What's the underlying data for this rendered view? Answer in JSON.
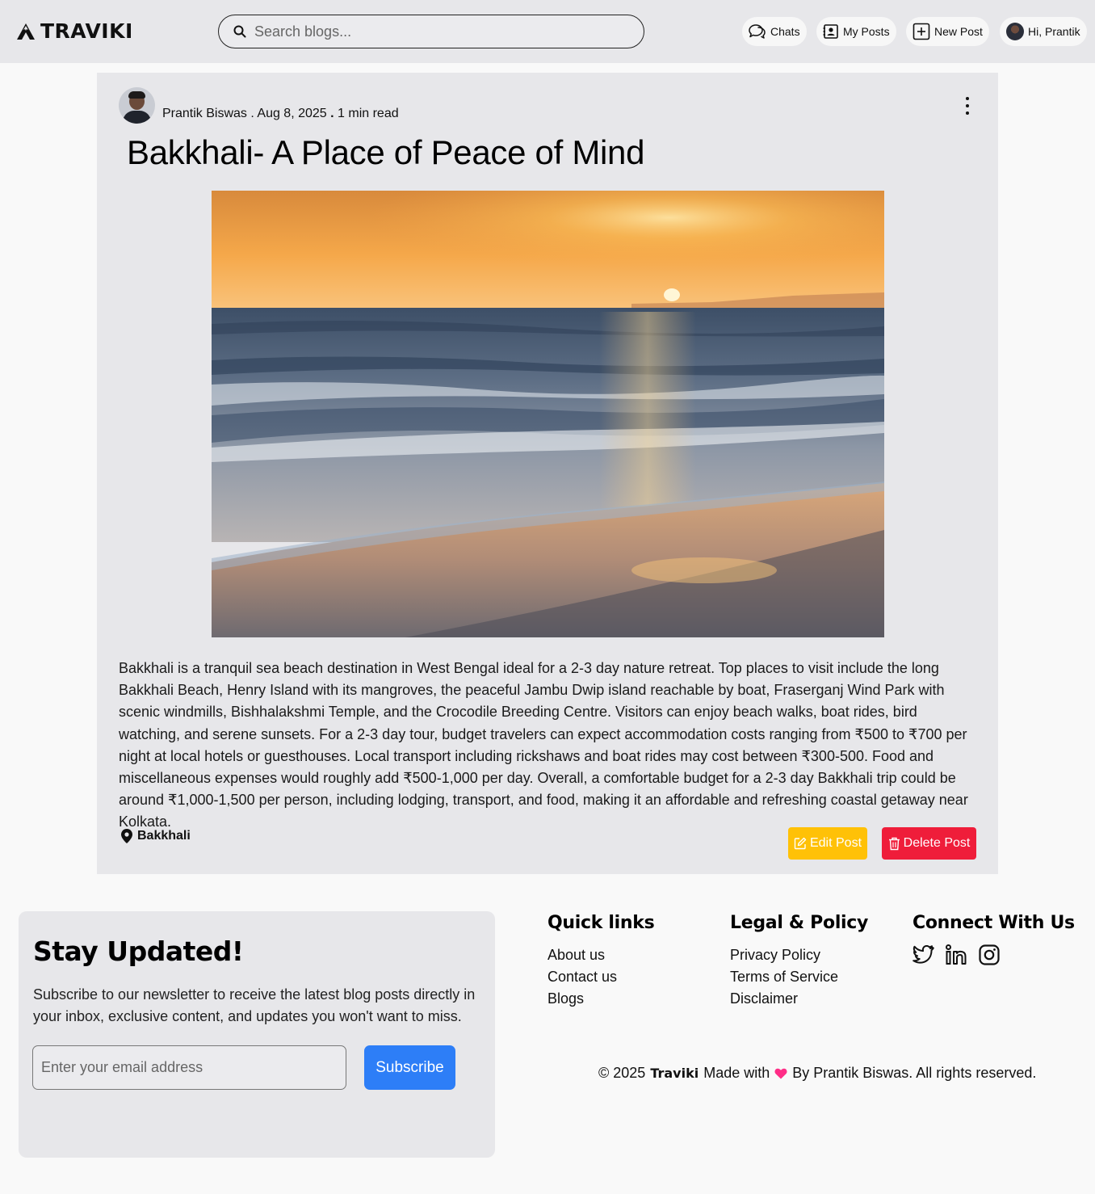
{
  "header": {
    "brand": "TRAVIKI",
    "search_placeholder": "Search blogs...",
    "nav": [
      {
        "label": "Chats",
        "icon": "chat-icon"
      },
      {
        "label": "My Posts",
        "icon": "contact-book-icon"
      },
      {
        "label": "New Post",
        "icon": "plus-square-icon"
      },
      {
        "label": "Hi, Prantik",
        "icon": "avatar"
      }
    ]
  },
  "post": {
    "author": "Prantik Biswas",
    "date": "Aug 8, 2025",
    "read_time": "1 min read",
    "title": "Bakkhali- A Place of Peace of Mind",
    "image_subject": "sunset over sea beach",
    "body": "Bakkhali is a tranquil sea beach destination in West Bengal ideal for a 2-3 day nature retreat. Top places to visit include the long Bakkhali Beach, Henry Island with its mangroves, the peaceful Jambu Dwip island reachable by boat, Fraserganj Wind Park with scenic windmills, Bishhalakshmi Temple, and the Crocodile Breeding Centre. Visitors can enjoy beach walks, boat rides, bird watching, and serene sunsets. For a 2-3 day tour, budget travelers can expect accommodation costs ranging from ₹500 to ₹700 per night at local hotels or guesthouses. Local transport including rickshaws and boat rides may cost between ₹300-500. Food and miscellaneous expenses would roughly add ₹500-1,000 per day. Overall, a comfortable budget for a 2-3 day Bakkhali trip could be around ₹1,000-1,500 per person, including lodging, transport, and food, making it an affordable and refreshing coastal getaway near Kolkata.",
    "location": "Bakkhali",
    "edit_label": "Edit Post",
    "delete_label": "Delete Post",
    "colors": {
      "edit": "#ffc107",
      "delete": "#ef1d3a"
    }
  },
  "newsletter": {
    "title": "Stay Updated!",
    "description": "Subscribe to our newsletter to receive the latest blog posts directly in your inbox, exclusive content, and updates you won't want to miss.",
    "email_placeholder": "Enter your email address",
    "button": "Subscribe",
    "button_color": "#2d7ef7"
  },
  "footer": {
    "quick_links": {
      "title": "Quick links",
      "items": [
        "About us",
        "Contact us",
        "Blogs"
      ]
    },
    "legal": {
      "title": "Legal & Policy",
      "items": [
        "Privacy Policy",
        "Terms of Service",
        "Disclaimer"
      ]
    },
    "connect": {
      "title": "Connect With Us",
      "icons": [
        "twitter-icon",
        "linkedin-icon",
        "instagram-icon"
      ]
    },
    "copyright": {
      "prefix": "© 2025",
      "brand": "Traviki",
      "made_with": "Made with",
      "suffix": "By Prantik Biswas. All rights reserved.",
      "heart_color": "#ff2d87"
    }
  }
}
